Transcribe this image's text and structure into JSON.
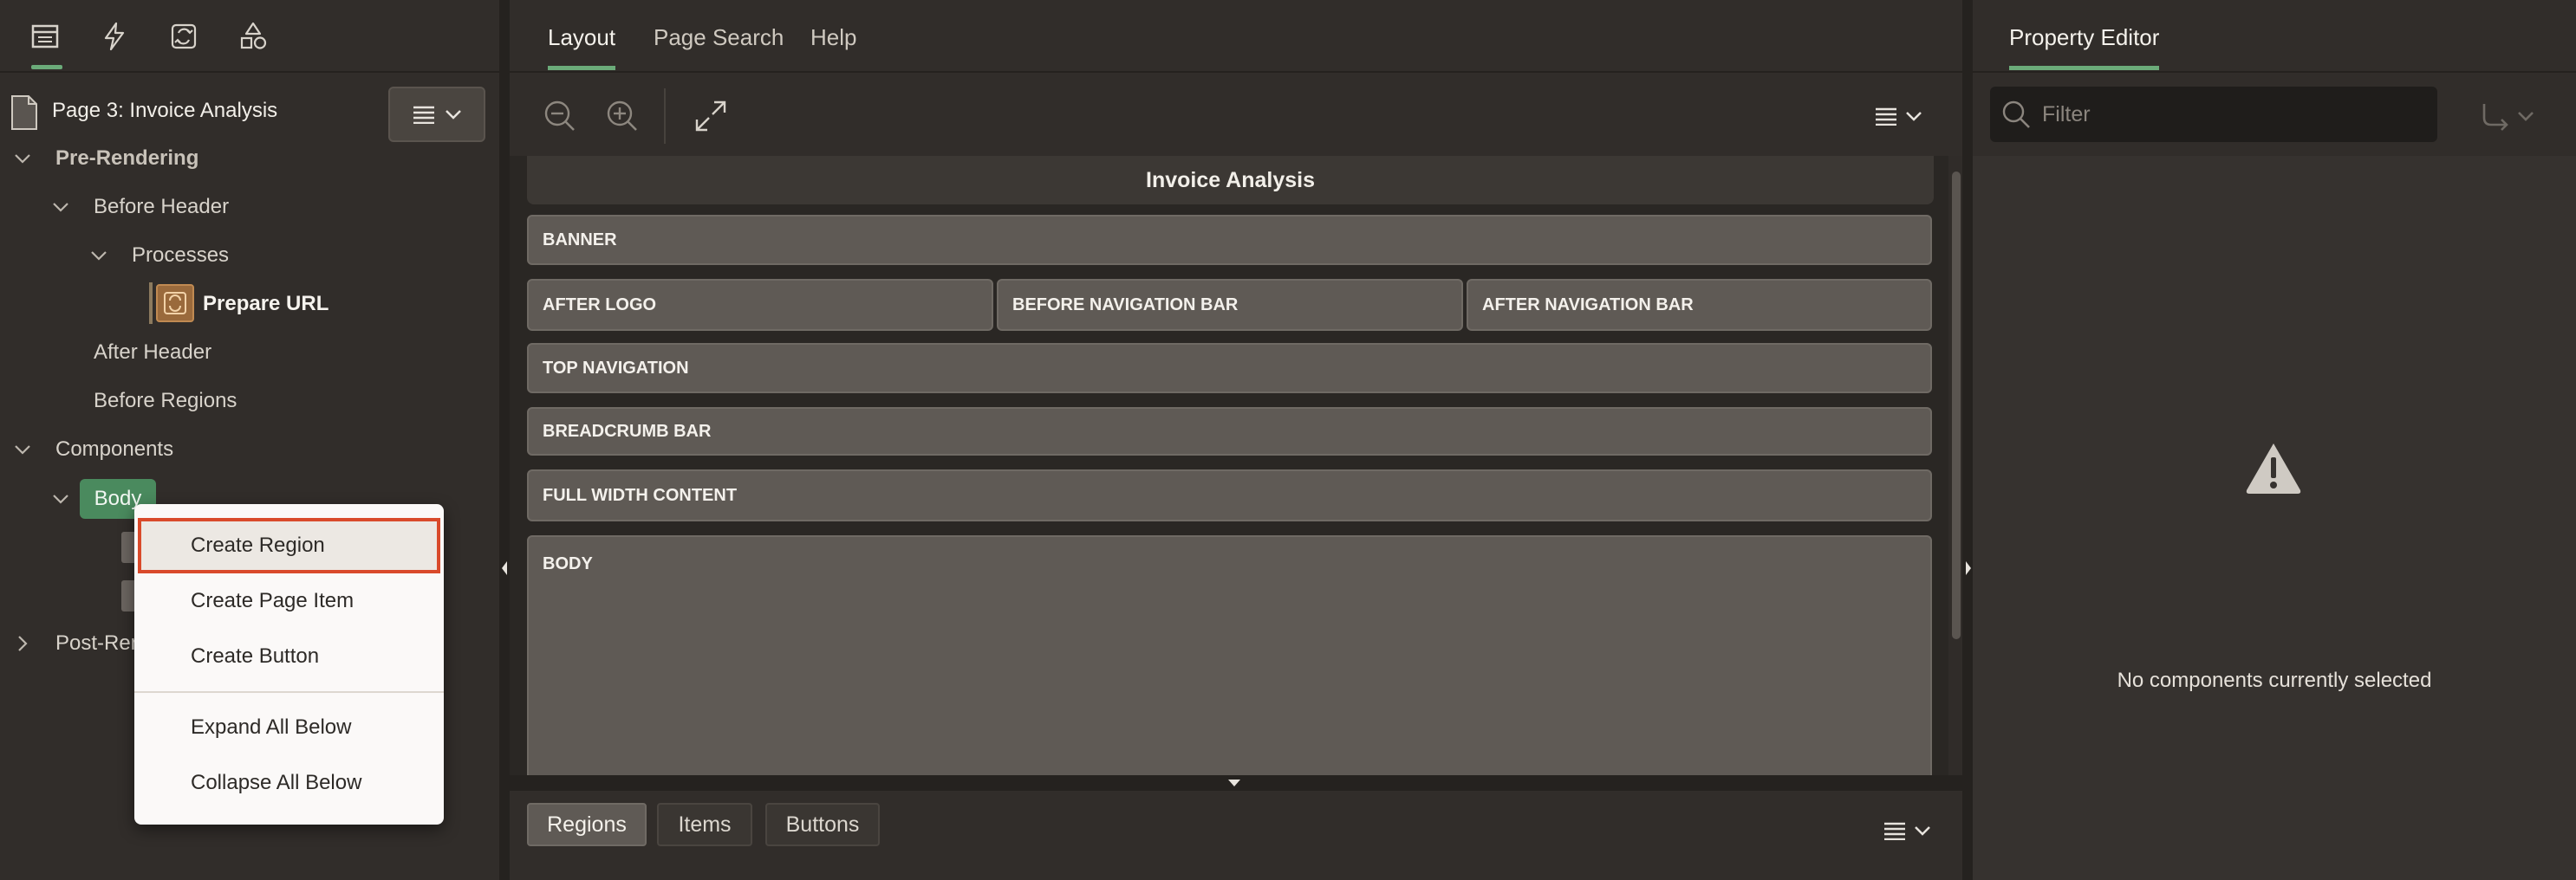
{
  "left_panel": {
    "tabs": [
      {
        "icon": "rendering-tree-icon",
        "active": true
      },
      {
        "icon": "dynamic-actions-icon"
      },
      {
        "icon": "processing-icon"
      },
      {
        "icon": "shared-components-icon"
      }
    ],
    "page_title": "Page 3: Invoice Analysis",
    "tree": {
      "pre_rendering": "Pre-Rendering",
      "before_header": "Before Header",
      "processes": "Processes",
      "prepare_url": "Prepare URL",
      "after_header": "After Header",
      "before_regions": "Before Regions",
      "components": "Components",
      "body": "Body",
      "post_rendering": "Post-Rendering"
    }
  },
  "context_menu": {
    "items": [
      "Create Region",
      "Create Page Item",
      "Create Button",
      "Expand All Below",
      "Collapse All Below"
    ],
    "selected": "Create Region"
  },
  "center": {
    "tabs": [
      "Layout",
      "Page Search",
      "Help"
    ],
    "active_tab": "Layout",
    "canvas_title": "Invoice Analysis",
    "slots": {
      "banner": "BANNER",
      "after_logo": "AFTER LOGO",
      "before_nav": "BEFORE NAVIGATION BAR",
      "after_nav": "AFTER NAVIGATION BAR",
      "top_nav": "TOP NAVIGATION",
      "breadcrumb": "BREADCRUMB BAR",
      "full_width": "FULL WIDTH CONTENT",
      "body": "BODY"
    },
    "bottom_tabs": [
      "Regions",
      "Items",
      "Buttons"
    ],
    "bottom_active": "Regions"
  },
  "right_panel": {
    "title": "Property Editor",
    "filter_placeholder": "Filter",
    "empty_message": "No components currently selected"
  },
  "colors": {
    "accent_green": "#6bab79",
    "menu_highlight_border": "#d94a2b",
    "body_node_bg": "#4a8a5e"
  }
}
